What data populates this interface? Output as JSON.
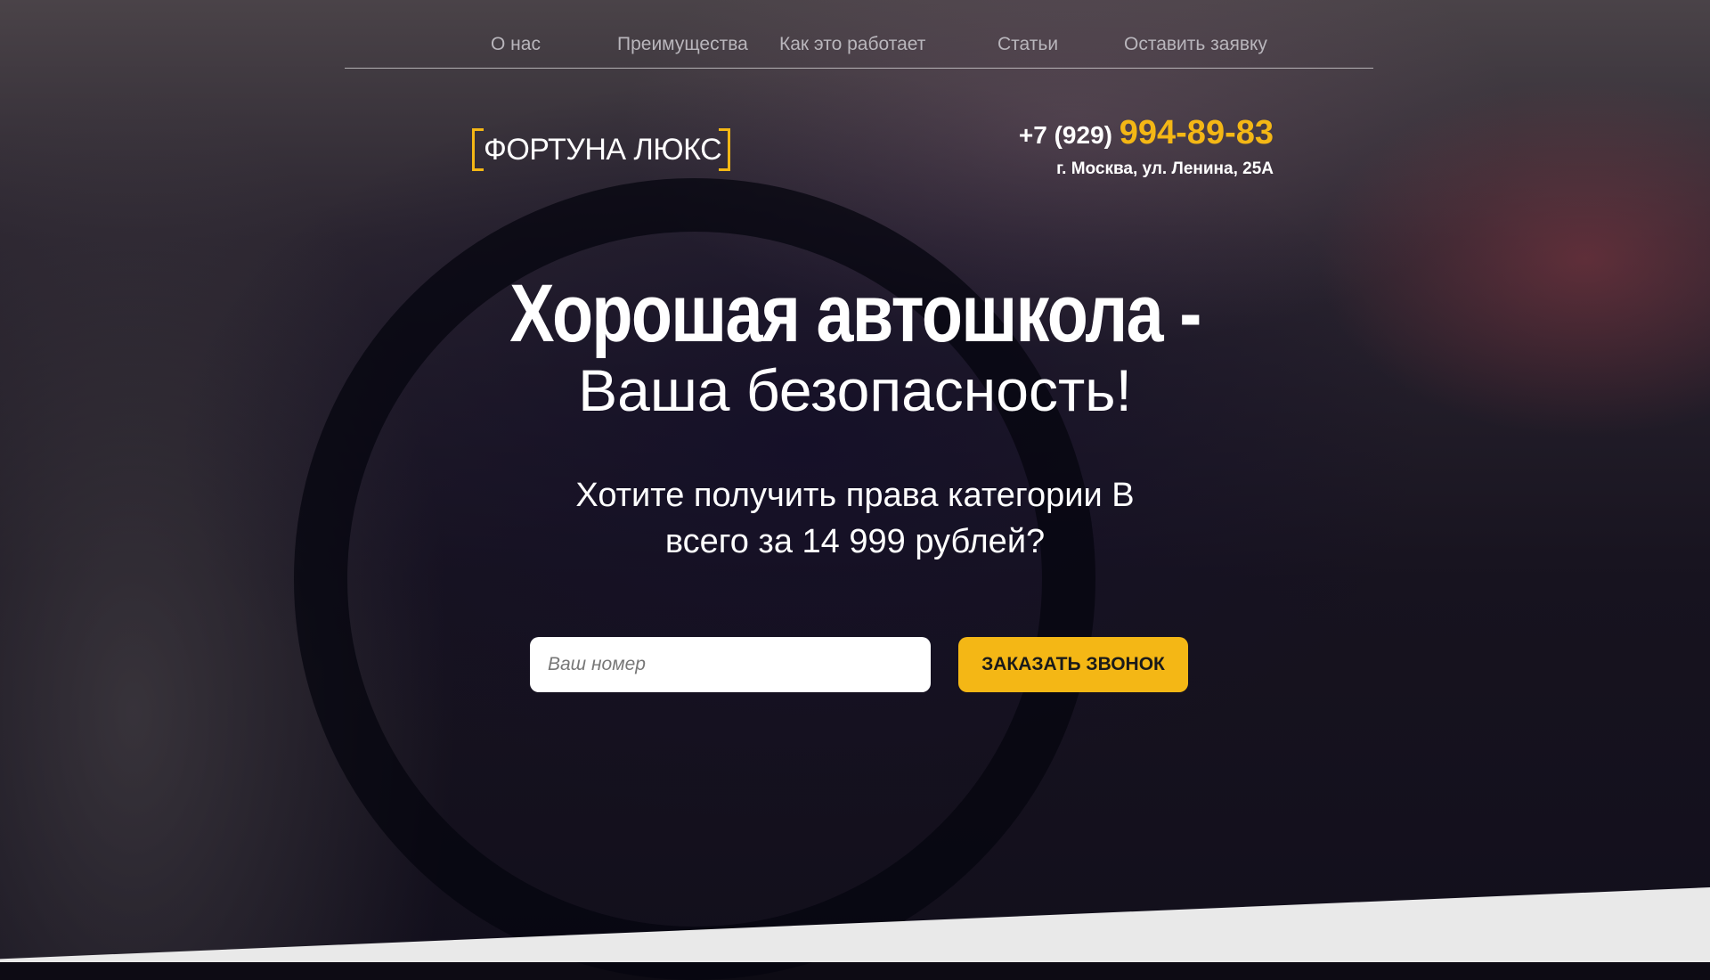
{
  "nav": {
    "items": [
      "О нас",
      "Преимущества",
      "Как это работает",
      "Статьи",
      "Оставить заявку"
    ]
  },
  "logo": {
    "text": "ФОРТУНА ЛЮКС"
  },
  "contact": {
    "phone_prefix": "+7 (929)",
    "phone_number": "994-89-83",
    "address": "г. Москва, ул. Ленина, 25А"
  },
  "hero": {
    "title": "Хорошая автошкола -",
    "subtitle": "Ваша безопасность!",
    "offer_line1": "Хотите получить права категории В",
    "offer_line2": "всего за 14 999 рублей?"
  },
  "form": {
    "phone_placeholder": "Ваш номер",
    "submit_label": "ЗАКАЗАТЬ ЗВОНОК"
  },
  "colors": {
    "accent": "#f4b715"
  }
}
